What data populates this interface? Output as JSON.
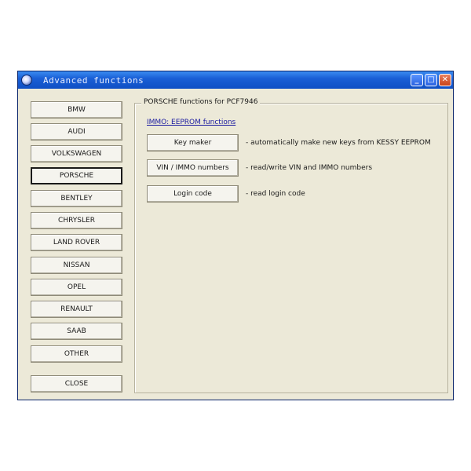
{
  "window": {
    "title": "Advanced functions"
  },
  "brands": [
    {
      "label": "BMW"
    },
    {
      "label": "AUDI"
    },
    {
      "label": "VOLKSWAGEN"
    },
    {
      "label": "PORSCHE"
    },
    {
      "label": "BENTLEY"
    },
    {
      "label": "CHRYSLER"
    },
    {
      "label": "LAND ROVER"
    },
    {
      "label": "NISSAN"
    },
    {
      "label": "OPEL"
    },
    {
      "label": "RENAULT"
    },
    {
      "label": "SAAB"
    },
    {
      "label": "OTHER"
    }
  ],
  "selected_brand": "PORSCHE",
  "close_label": "CLOSE",
  "panel": {
    "title": "PORSCHE functions for PCF7946",
    "section_link": "IMMO: EEPROM functions",
    "functions": [
      {
        "label": "Key maker",
        "description": "- automatically make new keys from KESSY EEPROM"
      },
      {
        "label": "VIN / IMMO numbers",
        "description": "- read/write VIN and IMMO numbers"
      },
      {
        "label": "Login code",
        "description": "- read login code"
      }
    ]
  },
  "icons": {
    "app": "app-icon",
    "minimize": "minimize-icon",
    "maximize": "maximize-icon",
    "close": "close-icon"
  }
}
